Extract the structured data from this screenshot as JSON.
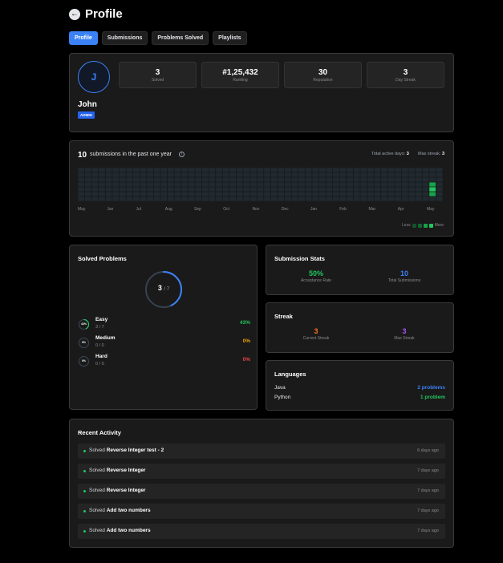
{
  "header": {
    "title": "Profile",
    "back_icon": "arrow-left-icon"
  },
  "tabs": [
    {
      "label": "Profile",
      "active": true
    },
    {
      "label": "Submissions",
      "active": false
    },
    {
      "label": "Problems Solved",
      "active": false
    },
    {
      "label": "Playlists",
      "active": false
    }
  ],
  "profile": {
    "avatar_initial": "J",
    "name": "John",
    "role_badge": "ADMIN",
    "stats": [
      {
        "value": "3",
        "label": "Solved"
      },
      {
        "value": "#1,25,432",
        "label": "Ranking"
      },
      {
        "value": "30",
        "label": "Reputation"
      },
      {
        "value": "3",
        "label": "Day Streak"
      }
    ]
  },
  "submissions": {
    "count": "10",
    "text": "submissions in the past one year",
    "active_days_label": "Total active days:",
    "active_days_value": "3",
    "max_streak_label": "Max streak:",
    "max_streak_value": "3",
    "months": [
      "May",
      "Jun",
      "Jul",
      "Aug",
      "Sep",
      "Oct",
      "Nov",
      "Dec",
      "Jan",
      "Feb",
      "Mar",
      "Apr",
      "May"
    ],
    "legend_less": "Less",
    "legend_more": "More"
  },
  "solved": {
    "title": "Solved Problems",
    "solved": "3",
    "total": "7",
    "difficulties": [
      {
        "name": "Easy",
        "count": "3 / 7",
        "pct": "43%",
        "ring_label": "43%",
        "fraction": 0.43,
        "color": "#22c55e"
      },
      {
        "name": "Medium",
        "count": "0 / 0",
        "pct": "0%",
        "ring_label": "0%",
        "fraction": 0,
        "color": "#f59e0b"
      },
      {
        "name": "Hard",
        "count": "0 / 0",
        "pct": "0%",
        "ring_label": "0%",
        "fraction": 0,
        "color": "#ef4444"
      }
    ]
  },
  "submission_stats": {
    "title": "Submission Stats",
    "acceptance_value": "50%",
    "acceptance_label": "Acceptance Rate",
    "total_value": "10",
    "total_label": "Total Submissions"
  },
  "streak": {
    "title": "Streak",
    "current_value": "3",
    "current_label": "Current Streak",
    "max_value": "3",
    "max_label": "Max Streak"
  },
  "languages": {
    "title": "Languages",
    "items": [
      {
        "name": "Java",
        "value": "2 problems"
      },
      {
        "name": "Python",
        "value": "1 problem"
      }
    ]
  },
  "activity": {
    "title": "Recent Activity",
    "prefix": "Solved",
    "items": [
      {
        "problem": "Reverse Integer test - 2",
        "time": "6 days ago"
      },
      {
        "problem": "Reverse Integer",
        "time": "7 days ago"
      },
      {
        "problem": "Reverse Integer",
        "time": "7 days ago"
      },
      {
        "problem": "Add two numbers",
        "time": "7 days ago"
      },
      {
        "problem": "Add two numbers",
        "time": "7 days ago"
      }
    ]
  },
  "colors": {
    "accent": "#3b82f6",
    "easy": "#22c55e",
    "medium": "#f59e0b",
    "hard": "#ef4444",
    "streak_current": "#f97316",
    "streak_max": "#a855f7"
  }
}
